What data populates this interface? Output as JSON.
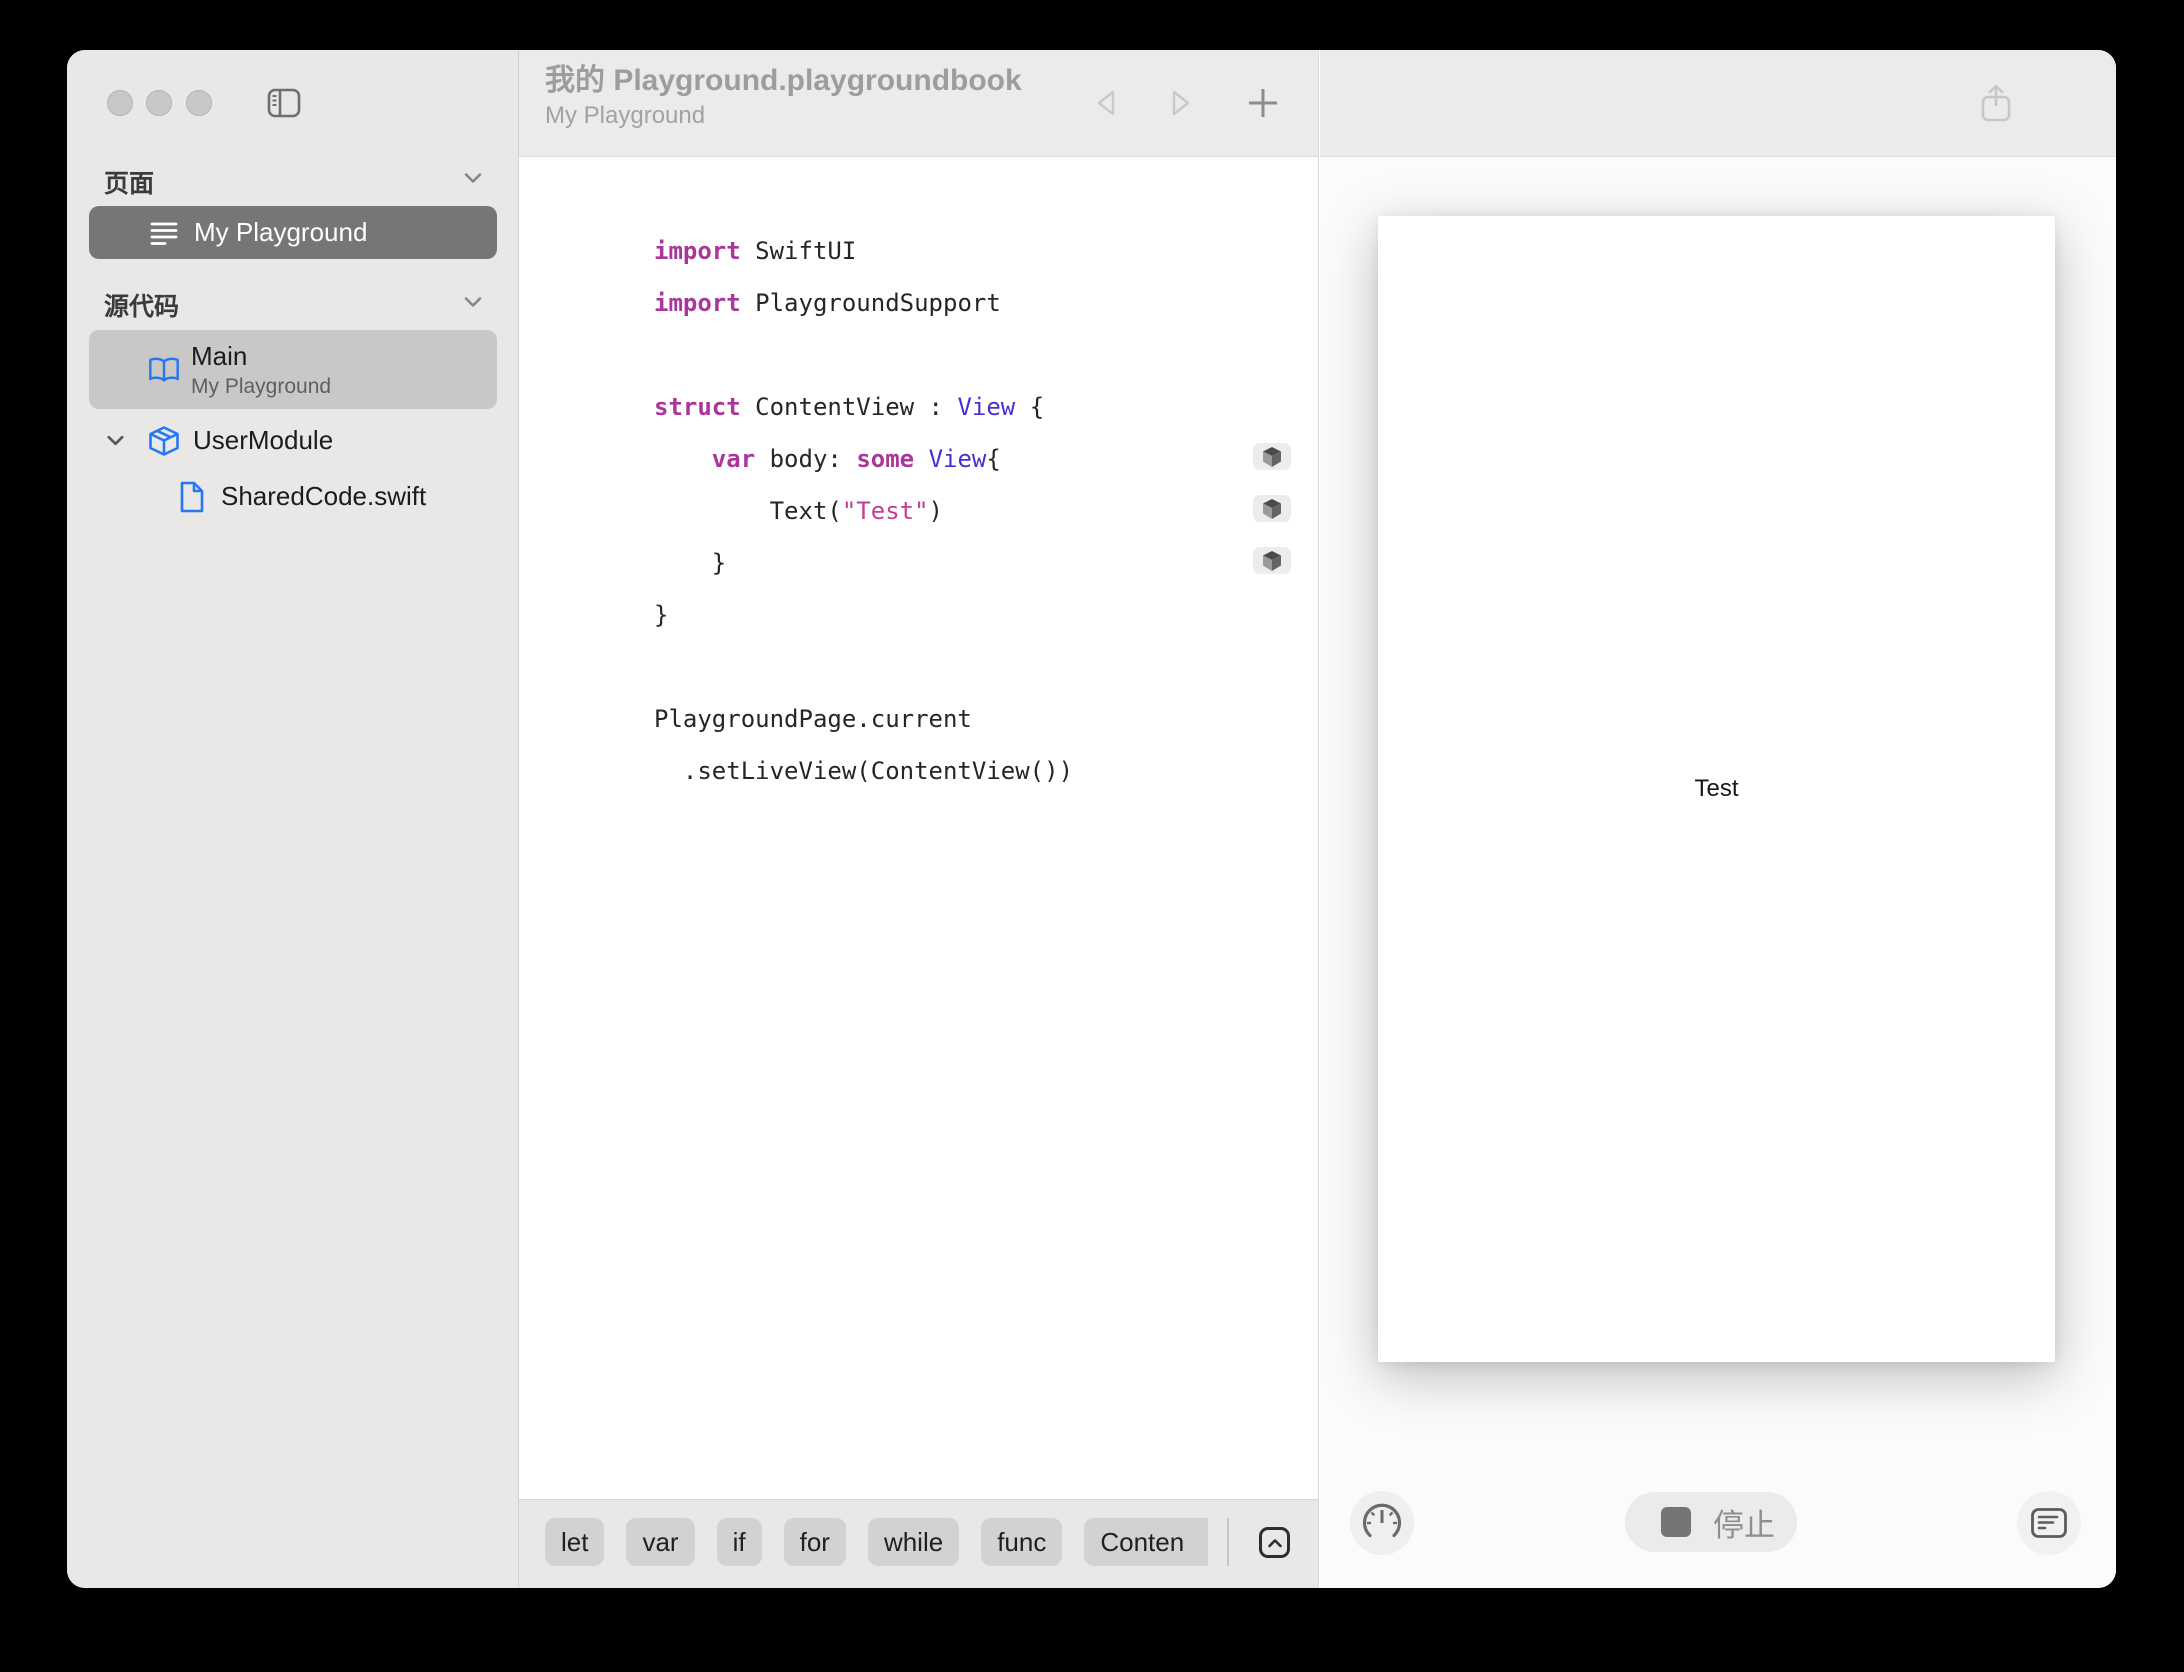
{
  "colors": {
    "keyword": "#a9379b",
    "type": "#4b2ed3",
    "string": "#c33e98",
    "plain": "#262626",
    "accent_blue": "#2577f4",
    "selected_row": "#777675"
  },
  "window": {
    "title": "我的 Playground.playgroundbook",
    "subtitle": "My Playground"
  },
  "sidebar": {
    "pages_header": "页面",
    "source_header": "源代码",
    "page_item_label": "My Playground",
    "main_item_title": "Main",
    "main_item_subtitle": "My Playground",
    "module_item_label": "UserModule",
    "file_item_label": "SharedCode.swift"
  },
  "editor": {
    "code": {
      "lines": [
        [
          {
            "text": "import",
            "style": "k"
          },
          {
            "text": " SwiftUI",
            "style": "p"
          }
        ],
        [
          {
            "text": "import",
            "style": "k"
          },
          {
            "text": " PlaygroundSupport",
            "style": "p"
          }
        ],
        [],
        [
          {
            "text": "struct",
            "style": "k"
          },
          {
            "text": " ContentView : ",
            "style": "p"
          },
          {
            "text": "View",
            "style": "t"
          },
          {
            "text": " {",
            "style": "p"
          }
        ],
        [
          {
            "text": "    ",
            "style": "p"
          },
          {
            "text": "var",
            "style": "k"
          },
          {
            "text": " body: ",
            "style": "p"
          },
          {
            "text": "some",
            "style": "k"
          },
          {
            "text": " ",
            "style": "p"
          },
          {
            "text": "View",
            "style": "t"
          },
          {
            "text": "{",
            "style": "p"
          }
        ],
        [
          {
            "text": "        Text(",
            "style": "p"
          },
          {
            "text": "\"Test\"",
            "style": "s"
          },
          {
            "text": ")",
            "style": "p"
          }
        ],
        [
          {
            "text": "    }",
            "style": "p"
          }
        ],
        [
          {
            "text": "}",
            "style": "p"
          }
        ],
        [],
        [
          {
            "text": "PlaygroundPage.current",
            "style": "p"
          }
        ],
        [
          {
            "text": "  .setLiveView(ContentView())",
            "style": "p"
          }
        ]
      ]
    },
    "keyword_chips": [
      "let",
      "var",
      "if",
      "for",
      "while",
      "func",
      "Conten"
    ]
  },
  "preview": {
    "live_text": "Test"
  },
  "controls": {
    "stop_label": "停止"
  },
  "icons": [
    "close",
    "minimize",
    "zoom",
    "sidebar-toggle",
    "chevron-down",
    "page-lines",
    "open-book",
    "shipping-box",
    "document",
    "nav-back",
    "nav-forward",
    "add",
    "share",
    "result-cube",
    "keyboard-dismiss",
    "gauge",
    "stop-square",
    "console-log"
  ]
}
